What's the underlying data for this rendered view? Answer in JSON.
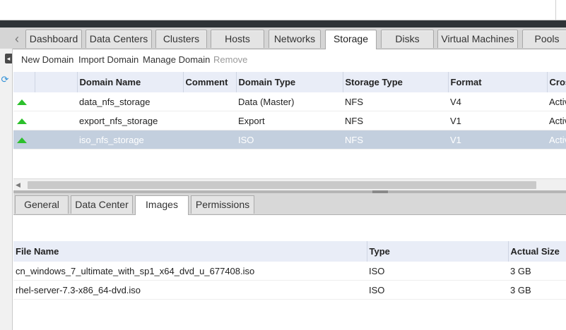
{
  "main_tabs": [
    "Dashboard",
    "Data Centers",
    "Clusters",
    "Hosts",
    "Networks",
    "Storage",
    "Disks",
    "Virtual Machines",
    "Pools"
  ],
  "active_main_tab": "Storage",
  "actions": {
    "new_domain": "New Domain",
    "import_domain": "Import Domain",
    "manage_domain": "Manage Domain",
    "remove": "Remove"
  },
  "domains_table": {
    "columns": [
      "Domain Name",
      "Comment",
      "Domain Type",
      "Storage Type",
      "Format",
      "Cros"
    ],
    "rows": [
      {
        "status": "up",
        "name": "data_nfs_storage",
        "comment": "",
        "domain_type": "Data (Master)",
        "storage_type": "NFS",
        "format": "V4",
        "cross": "Activ"
      },
      {
        "status": "up",
        "name": "export_nfs_storage",
        "comment": "",
        "domain_type": "Export",
        "storage_type": "NFS",
        "format": "V1",
        "cross": "Activ"
      },
      {
        "status": "up",
        "name": "iso_nfs_storage",
        "comment": "",
        "domain_type": "ISO",
        "storage_type": "NFS",
        "format": "V1",
        "cross": "Activ"
      }
    ],
    "selected_row": 2
  },
  "sub_tabs": [
    "General",
    "Data Center",
    "Images",
    "Permissions"
  ],
  "active_sub_tab": "Images",
  "images_table": {
    "columns": [
      "File Name",
      "Type",
      "Actual Size"
    ],
    "rows": [
      {
        "file_name": "cn_windows_7_ultimate_with_sp1_x64_dvd_u_677408.iso",
        "type": "ISO",
        "size": "3 GB"
      },
      {
        "file_name": "rhel-server-7.3-x86_64-dvd.iso",
        "type": "ISO",
        "size": "3 GB"
      }
    ]
  },
  "colors": {
    "selected_row": "#c3cfde",
    "header_bg": "#e9edf7",
    "status_up": "#2cc02c",
    "dark_band": "#2e3337"
  }
}
